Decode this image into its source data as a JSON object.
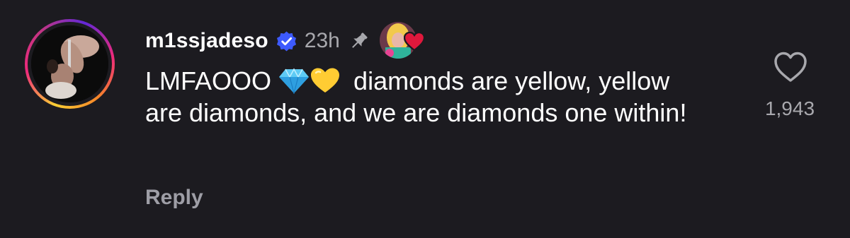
{
  "comment": {
    "username": "m1ssjadeso",
    "time": "23h",
    "text_before_emoji": "LMFAOOO ",
    "text_after_emoji": " diamonds are yellow, yellow are diamonds, and we are diamonds one within!",
    "reply_label": "Reply",
    "like_count": "1,943"
  },
  "icons": {
    "verified": "verified-badge-icon",
    "pin": "pin-icon",
    "heart": "heart-outline-icon",
    "liked_by_creator": "creator-liked-heart-icon"
  },
  "colors": {
    "background": "#1c1b20",
    "verified": "#3d5afe",
    "secondary_text": "#a8a8ad",
    "liked_heart": "#e0183c"
  }
}
